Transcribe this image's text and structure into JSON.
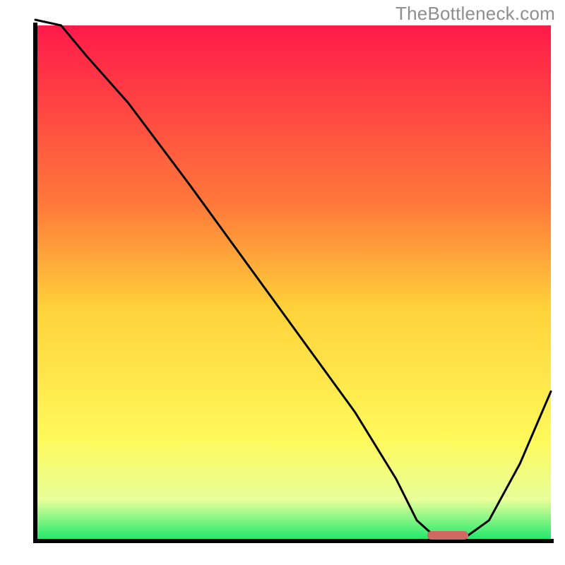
{
  "watermark": "TheBottleneck.com",
  "marker_color": "#d06864",
  "colors": {
    "axis": "#000000",
    "curve": "#000000"
  },
  "chart_data": {
    "type": "line",
    "title": "",
    "xlabel": "",
    "ylabel": "",
    "xlim": [
      0,
      100
    ],
    "ylim": [
      0,
      100
    ],
    "gradient_stops": [
      {
        "offset": 0,
        "color": "#ff1a4a"
      },
      {
        "offset": 35,
        "color": "#ff7a3a"
      },
      {
        "offset": 55,
        "color": "#ffd23a"
      },
      {
        "offset": 80,
        "color": "#fff95a"
      },
      {
        "offset": 92,
        "color": "#e8ff9a"
      },
      {
        "offset": 100,
        "color": "#17e86a"
      }
    ],
    "series": [
      {
        "name": "bottleneck-curve",
        "x": [
          0,
          5,
          10,
          18,
          24,
          30,
          38,
          46,
          54,
          62,
          70,
          74,
          78,
          83,
          88,
          94,
          100
        ],
        "y": [
          104,
          100,
          94,
          85,
          77,
          69,
          58,
          47,
          36,
          25,
          12,
          4,
          0,
          0,
          4,
          15,
          29
        ]
      }
    ],
    "flat_marker": {
      "x_start": 76,
      "x_end": 84,
      "y": 0
    }
  }
}
